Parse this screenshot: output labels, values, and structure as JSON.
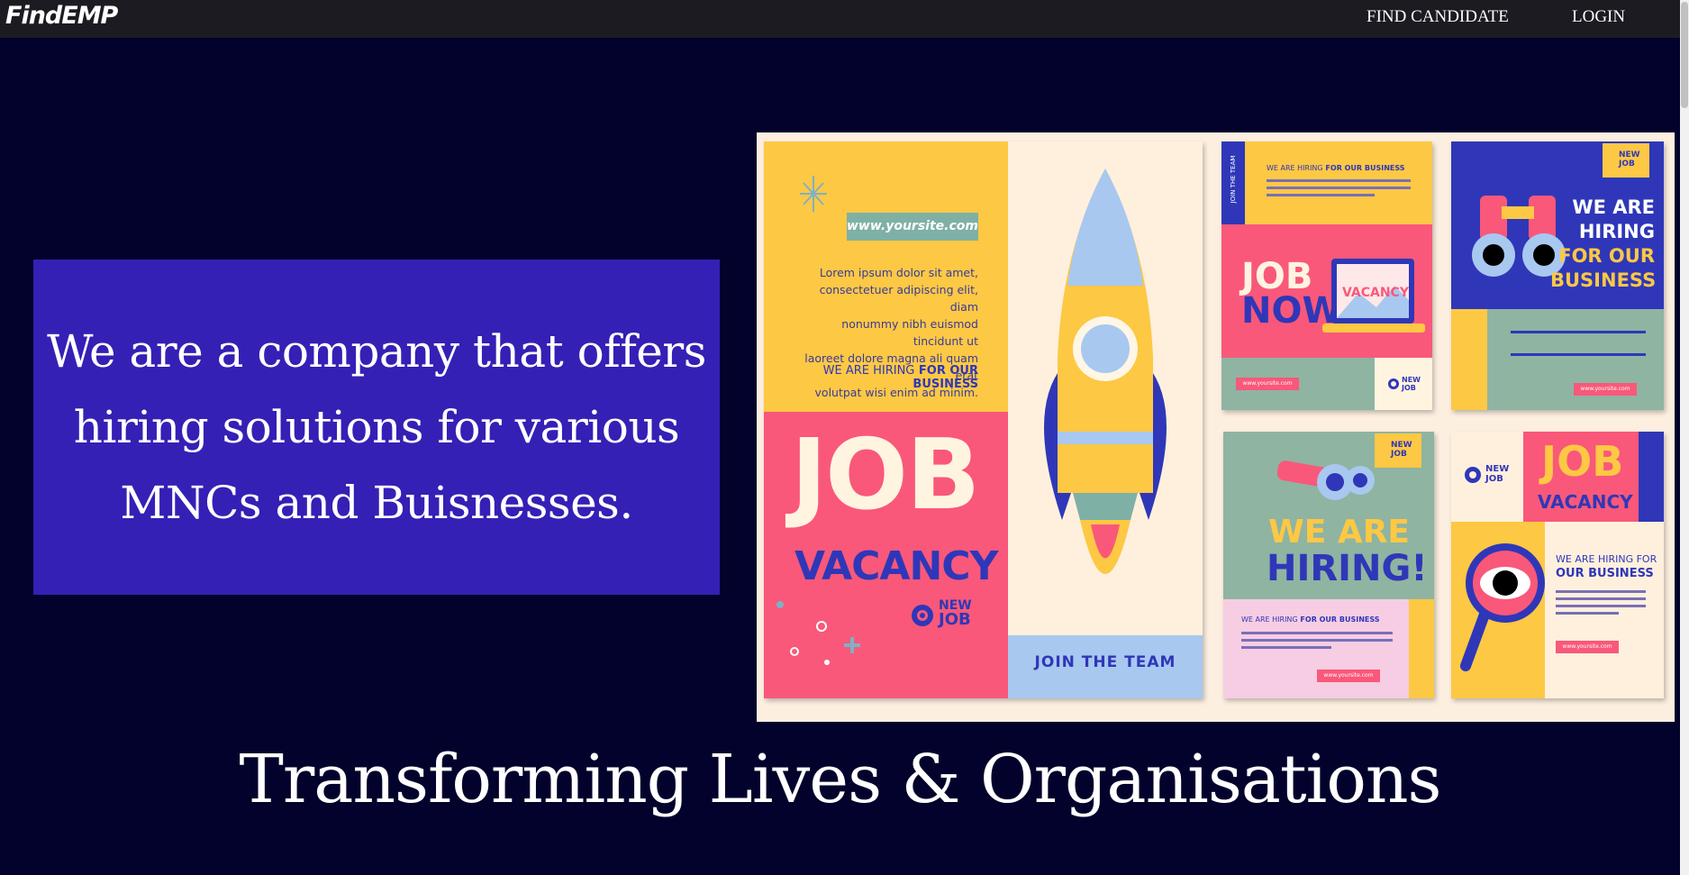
{
  "nav": {
    "logo": "FindEMP",
    "links": [
      "FIND CANDIDATE",
      "LOGIN"
    ]
  },
  "hero": {
    "lines": [
      "We are a company that offers",
      "hiring solutions for various",
      "MNCs and Buisnesses."
    ]
  },
  "poster": {
    "site": "www.yoursite.com",
    "lorem_lines": [
      "Lorem ipsum dolor sit amet,",
      "consectetuer adipiscing elit, diam",
      "nonummy nibh euismod tincidunt ut",
      "laoreet dolore magna ali quam erat",
      "volutpat wisi enim ad minim."
    ],
    "hiring_prefix": "WE ARE HIRING",
    "hiring_suffix": "FOR OUR BUSINESS",
    "job": "JOB",
    "vacancy": "VACANCY",
    "new": "NEW",
    "join_team": "JOIN THE TEAM",
    "job_now_1": "JOB",
    "job_now_2": "NOW",
    "we_are_hiring_1": "WE ARE",
    "we_are_hiring_2": "HIRING!",
    "hiring_big": [
      "WE ARE",
      "HIRING",
      "FOR OUR",
      "BUSINESS"
    ],
    "hiring_for": "WE ARE HIRING FOR",
    "our_business": "OUR BUSINESS",
    "vacancy_screen": "VACANCY"
  },
  "tagline": "Transforming Lives & Organisations",
  "colors": {
    "background": "#03022c",
    "navbar": "#1c1b22",
    "hero_box": "#3420b5",
    "poster_yellow": "#fdc844",
    "poster_pink": "#f9587a",
    "poster_blue": "#2f37b8",
    "poster_teal": "#8fb4a2",
    "poster_cream": "#fdefe0"
  }
}
